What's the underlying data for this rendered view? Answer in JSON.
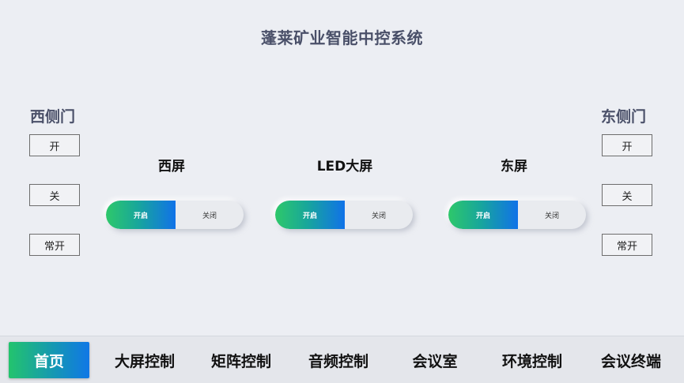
{
  "app_title": "蓬莱矿业智能中控系统",
  "west_door": {
    "title": "西侧门",
    "buttons": [
      "开",
      "关",
      "常开"
    ]
  },
  "east_door": {
    "title": "东侧门",
    "buttons": [
      "开",
      "关",
      "常开"
    ]
  },
  "screens": [
    {
      "title": "西屏",
      "on_label": "开启",
      "off_label": "关闭",
      "state": "on"
    },
    {
      "title": "LED大屏",
      "on_label": "开启",
      "off_label": "关闭",
      "state": "on"
    },
    {
      "title": "东屏",
      "on_label": "开启",
      "off_label": "关闭",
      "state": "on"
    }
  ],
  "nav": {
    "active": "首页",
    "items": [
      "首页",
      "大屏控制",
      "矩阵控制",
      "音频控制",
      "会议室",
      "环境控制",
      "会议终端"
    ]
  },
  "colors": {
    "background": "#eceef3",
    "title_text": "#4a5069",
    "accent_green": "#2ec86a",
    "accent_blue": "#1072e8"
  }
}
